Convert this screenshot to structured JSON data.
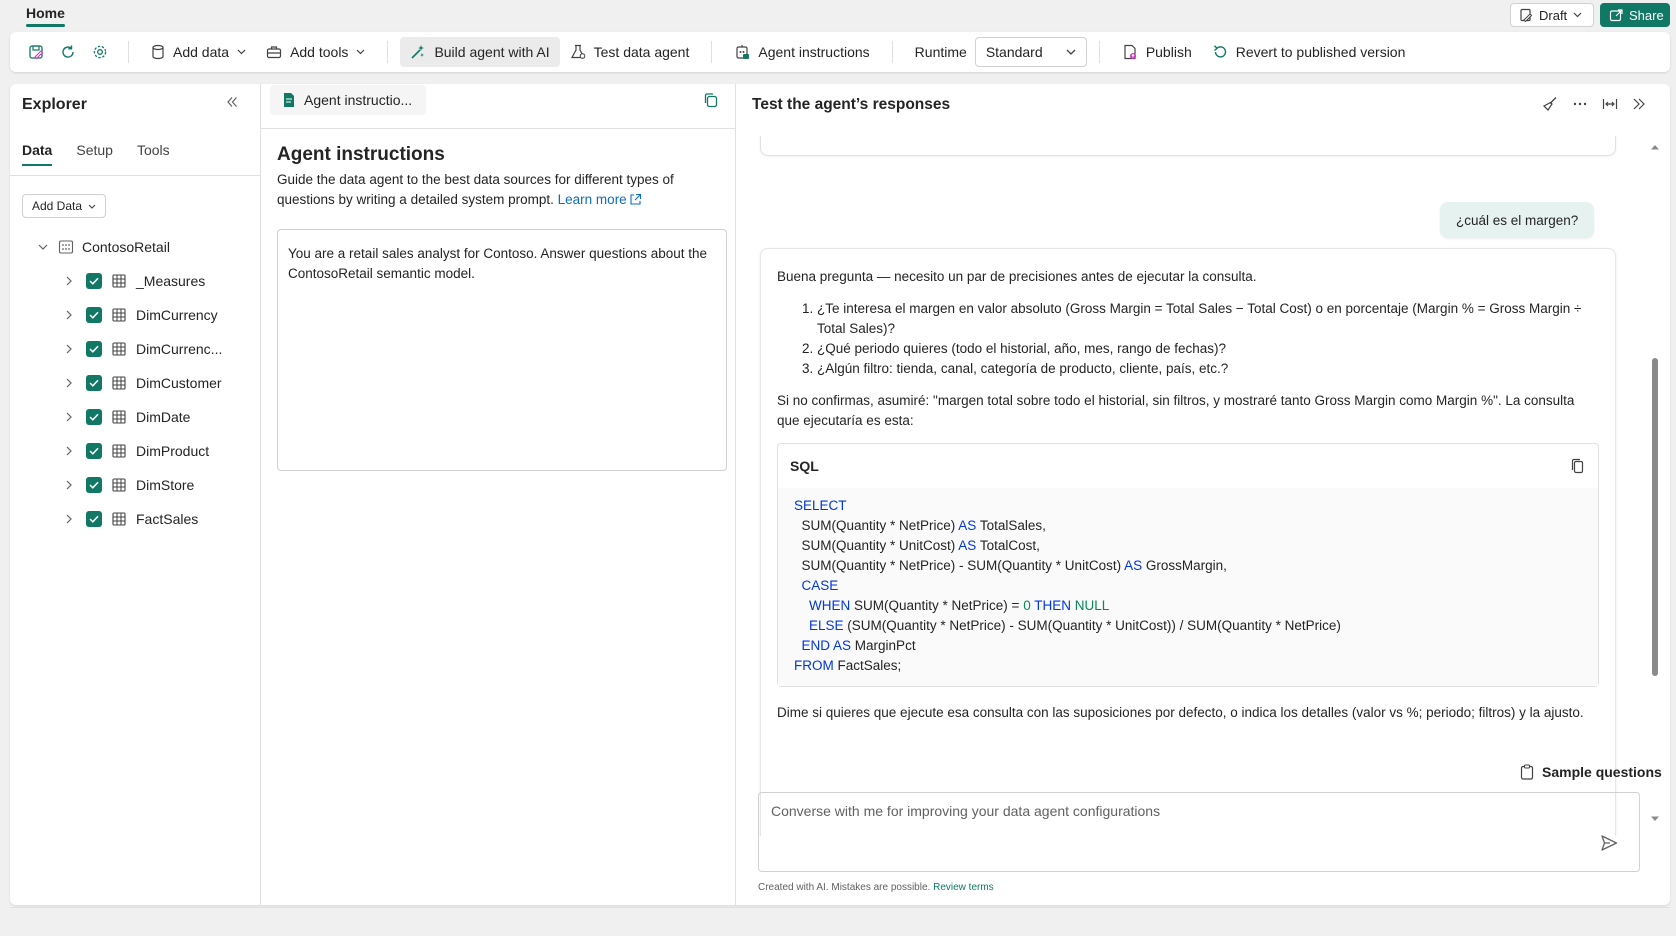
{
  "topbar": {
    "home_tab": "Home",
    "draft_label": "Draft",
    "share_label": "Share"
  },
  "ribbon": {
    "add_data": "Add data",
    "add_tools": "Add tools",
    "build_agent": "Build agent with AI",
    "test_agent": "Test data agent",
    "agent_instructions": "Agent instructions",
    "runtime_label": "Runtime",
    "runtime_value": "Standard",
    "publish": "Publish",
    "revert": "Revert to published version"
  },
  "explorer": {
    "title": "Explorer",
    "tabs": [
      {
        "label": "Data"
      },
      {
        "label": "Setup"
      },
      {
        "label": "Tools"
      }
    ],
    "add_data_btn": "Add Data",
    "root": "ContosoRetail",
    "items": [
      {
        "label": "_Measures"
      },
      {
        "label": "DimCurrency"
      },
      {
        "label": "DimCurrenc..."
      },
      {
        "label": "DimCustomer"
      },
      {
        "label": "DimDate"
      },
      {
        "label": "DimProduct"
      },
      {
        "label": "DimStore"
      },
      {
        "label": "FactSales"
      }
    ]
  },
  "instructions": {
    "tab_label": "Agent instructio...",
    "heading": "Agent instructions",
    "description": "Guide the data agent to the best data sources for different types of questions by writing a detailed system prompt.",
    "learn_more": "Learn more",
    "prompt_text": "You are a retail sales analyst for Contoso. Answer questions about the ContosoRetail semantic model."
  },
  "chat": {
    "title": "Test the agent’s responses",
    "user_message": "¿cuál es el margen?",
    "bot_intro": "Buena pregunta — necesito un par de precisiones antes de ejecutar la consulta.",
    "bot_questions": [
      "¿Te interesa el margen en valor absoluto (Gross Margin = Total Sales − Total Cost) o en porcentaje (Margin % = Gross Margin ÷ Total Sales)?",
      "¿Qué periodo quieres (todo el historial, año, mes, rango de fechas)?",
      "¿Algún filtro: tienda, canal, categoría de producto, cliente, país, etc.?"
    ],
    "bot_assume": "Si no confirmas, asumiré: \"margen total sobre todo el historial, sin filtros, y mostraré tanto Gross Margin como Margin %\". La consulta que ejecutaría es esta:",
    "sql_label": "SQL",
    "bot_outro": "Dime si quieres que ejecute esa consulta con las suposiciones por defecto, o indica los detalles (valor vs %; periodo; filtros) y la ajusto.",
    "sample_questions": "Sample questions",
    "input_placeholder": "Converse with me for improving your data agent configurations",
    "disclaimer": "Created with AI. Mistakes are possible.",
    "review_terms": "Review terms"
  },
  "colors": {
    "accent": "#117865",
    "link": "#0f6cbd",
    "sql_keyword": "#0037da",
    "sql_number": "#098658"
  }
}
